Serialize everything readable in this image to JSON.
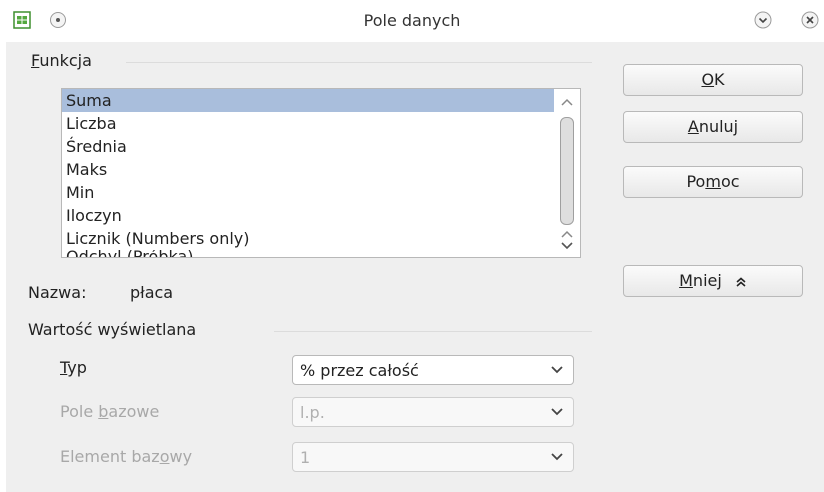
{
  "window": {
    "title": "Pole danych"
  },
  "funkcja": {
    "label": "Funkcja",
    "items": [
      "Suma",
      "Liczba",
      "Średnia",
      "Maks",
      "Min",
      "Iloczyn",
      "Licznik (Numbers only)",
      "Odchyl (Próbka)"
    ],
    "selected": "Suma"
  },
  "buttons": {
    "ok": "OK",
    "cancel": "Anuluj",
    "help": "Pomoc",
    "less": "Mniej"
  },
  "name": {
    "label": "Nazwa:",
    "value": "płaca"
  },
  "display": {
    "title": "Wartość wyświetlana",
    "type_label": "Typ",
    "type_value": "% przez całość",
    "base_field_label": "Pole bazowe",
    "base_field_value": "l.p.",
    "base_item_label": "Element bazowy",
    "base_item_value": "1"
  },
  "icons": {
    "app": "calc-icon",
    "window_menu": "window-menu-icon",
    "minimize": "minimize-icon",
    "close": "close-icon"
  }
}
